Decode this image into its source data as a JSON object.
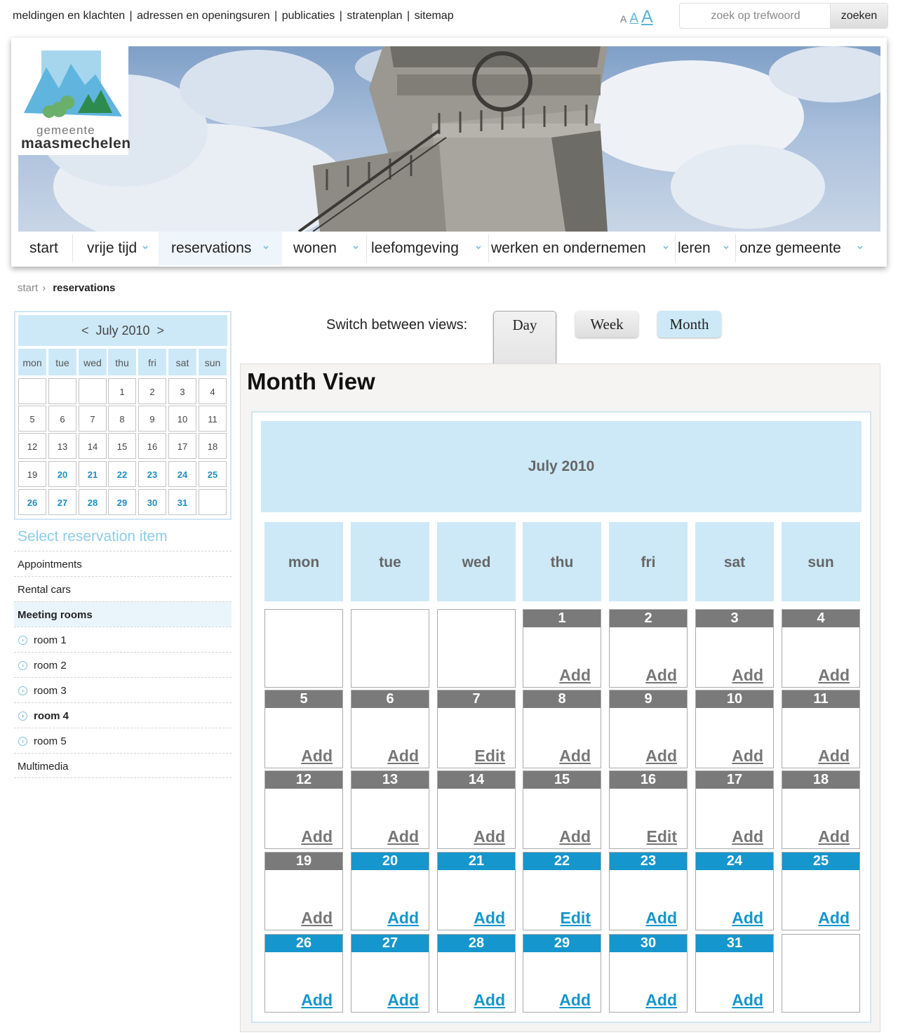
{
  "top_links": [
    "meldingen en klachten",
    "adressen en openingsuren",
    "publicaties",
    "stratenplan",
    "sitemap"
  ],
  "font_sizes": [
    "A",
    "A",
    "A"
  ],
  "search": {
    "placeholder": "zoek op trefwoord",
    "button": "zoeken"
  },
  "logo": {
    "line1": "gemeente",
    "line2": "maasmechelen"
  },
  "nav": [
    {
      "label": "start"
    },
    {
      "label": "vrije tijd"
    },
    {
      "label": "reservations"
    },
    {
      "label": "wonen"
    },
    {
      "label": "leefomgeving"
    },
    {
      "label": "werken en ondernemen"
    },
    {
      "label": "leren"
    },
    {
      "label": "onze gemeente"
    }
  ],
  "breadcrumb": {
    "home": "start",
    "sep": "›",
    "current": "reservations"
  },
  "mini_calendar": {
    "prev": "<",
    "next": ">",
    "title": "July 2010",
    "weekdays": [
      "mon",
      "tue",
      "wed",
      "thu",
      "fri",
      "sat",
      "sun"
    ]
  },
  "sidebar": {
    "title": "Select reservation item",
    "items": [
      "Appointments",
      "Rental cars",
      "Meeting rooms",
      "room 1",
      "room 2",
      "room 3",
      "room 4",
      "room 5",
      "Multimedia"
    ]
  },
  "view_switch": {
    "label": "Switch between views:",
    "day": "Day",
    "week": "Week",
    "month": "Month"
  },
  "month_view": {
    "title": "Month View",
    "month_label": "July 2010",
    "weekdays": [
      "mon",
      "tue",
      "wed",
      "thu",
      "fri",
      "sat",
      "sun"
    ],
    "add_label": "Add",
    "edit_label": "Edit",
    "edit_days": [
      7,
      16,
      22
    ],
    "first_future_day": 20
  },
  "colors": {
    "accent": "#1596cc",
    "light_blue": "#cde9f7",
    "past_day": "#7a7a7a"
  }
}
